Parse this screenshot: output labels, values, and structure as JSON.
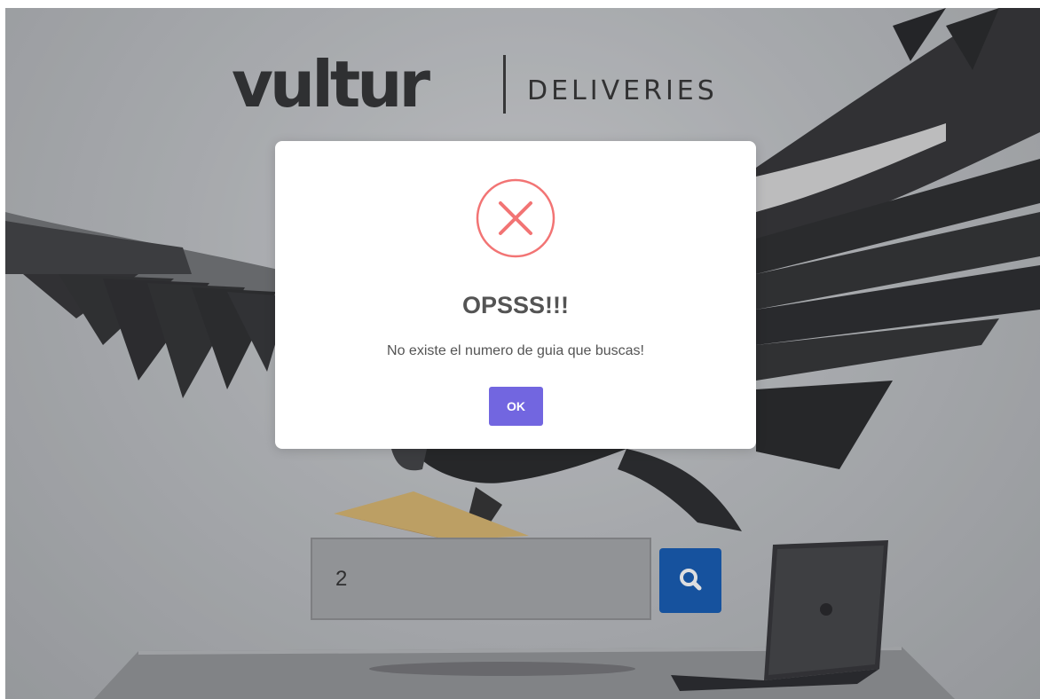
{
  "brand": {
    "main": "vultur",
    "sub": "DELIVERIES"
  },
  "modal": {
    "icon": "error-x-icon",
    "title": "OPSSS!!!",
    "message": "No existe el numero de guia que buscas!",
    "ok_label": "OK"
  },
  "search": {
    "value": "2",
    "icon": "search-icon"
  },
  "colors": {
    "ok_button": "#7266e0",
    "search_button": "#0b55b0",
    "error_icon": "#f27474"
  }
}
